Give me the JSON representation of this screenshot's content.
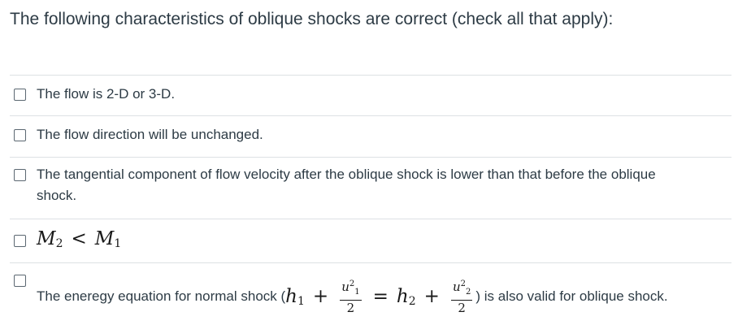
{
  "question": {
    "text": "The following characteristics of oblique shocks are correct (check all that apply):"
  },
  "answers": [
    {
      "label": "The flow is 2-D or 3-D.",
      "checked": false
    },
    {
      "label": "The flow direction will be unchanged.",
      "checked": false
    },
    {
      "label": "The tangential component of flow velocity after the oblique shock is lower than that before the oblique shock.",
      "checked": false
    },
    {
      "label_math": {
        "lhs": "M",
        "lhs_sub": "2",
        "op": "<",
        "rhs": "M",
        "rhs_sub": "1"
      },
      "checked": false
    },
    {
      "text_before": "The eneregy equation for normal shock (",
      "math": {
        "h1": "h",
        "h1_sub": "1",
        "plus": "+",
        "u1": "u",
        "u1_sub": "1",
        "u1_sup": "2",
        "den": "2",
        "equals": "=",
        "h2": "h",
        "h2_sub": "2",
        "u2": "u",
        "u2_sub": "2",
        "u2_sup": "2"
      },
      "text_after": ") is also valid for oblique shock.",
      "checked": false
    }
  ],
  "colors": {
    "text": "#2d3b45",
    "divider": "#dde1e4",
    "checkbox_border": "#5b6771"
  }
}
